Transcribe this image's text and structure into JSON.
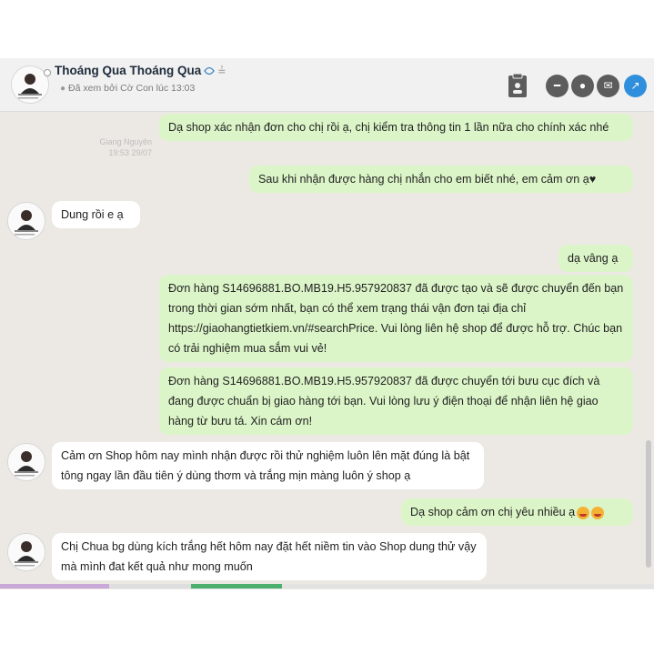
{
  "header": {
    "name": "Thoáng Qua Thoáng Qua",
    "seen_text": "Đã xem bởi Cờ Con lúc 13:03",
    "icons": [
      "verified-icon",
      "cake-icon",
      "clipboard-icon",
      "minus-icon",
      "chat-icon",
      "mail-icon",
      "share-icon"
    ]
  },
  "stamp": {
    "name": "Giang Nguyên",
    "time": "19:53 29/07"
  },
  "messages": [
    {
      "dir": "out",
      "text": "Dạ shop xác nhận đơn cho chị rồi ạ, chị kiểm tra thông tin 1 lần nữa cho chính xác nhé"
    },
    {
      "dir": "out",
      "text": "Sau khi nhận được hàng chị nhắn cho em biết nhé, em cảm ơn ạ♥"
    },
    {
      "dir": "in",
      "text": "Dung rồi e ạ"
    },
    {
      "dir": "out",
      "text": "dạ vâng ạ"
    },
    {
      "dir": "out",
      "text": "Đơn hàng S14696881.BO.MB19.H5.957920837 đã được tạo và sẽ được chuyển đến bạn trong thời gian sớm nhất, bạn có thể xem trạng thái vận đơn tại địa chỉ https://giaohangtietkiem.vn/#searchPrice. Vui lòng liên hệ shop để được hỗ trợ. Chúc bạn có trải nghiệm mua sắm vui vẻ!"
    },
    {
      "dir": "out",
      "text": "Đơn hàng S14696881.BO.MB19.H5.957920837 đã được chuyển tới bưu cục đích và đang được chuẩn bị giao hàng tới bạn. Vui lòng lưu ý điện thoại để nhận liên hệ giao hàng từ bưu tá. Xin cám ơn!"
    },
    {
      "dir": "in",
      "text": "Cảm ơn Shop hôm nay mình nhận được rồi thử nghiệm luôn lên mặt đúng là bật tông ngay lần đầu tiên ý dùng thơm và trắng mịn màng luôn ý shop ạ"
    },
    {
      "dir": "out",
      "text": "Dạ shop cảm ơn chị yêu nhiều ạ"
    },
    {
      "dir": "in",
      "text": "Chị Chua bg dùng kích trắng hết hôm nay đặt hết niềm tin vào Shop dung thử vậy mà mình đat kết quả như mong muốn"
    }
  ],
  "colors": {
    "outgoing": "#dcf5c8",
    "incoming": "#ffffff",
    "chat_bg": "#ece9e4",
    "share_blue": "#2f8fdc"
  }
}
